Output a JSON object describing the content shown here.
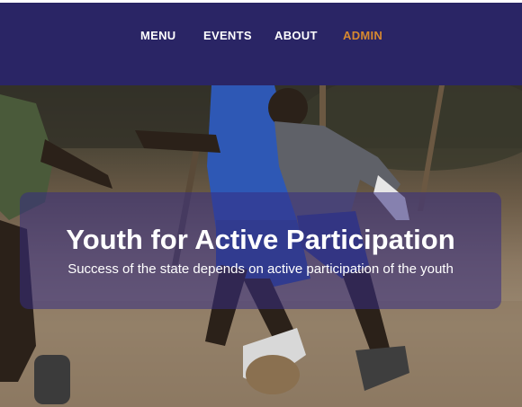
{
  "nav": {
    "items": [
      {
        "label": "MENU"
      },
      {
        "label": "EVENTS"
      },
      {
        "label": "ABOUT"
      },
      {
        "label": "ADMIN"
      }
    ],
    "active_item": "ADMIN",
    "background_color": "#2a2565",
    "active_color": "#d7892f"
  },
  "hero": {
    "title": "Youth for Active Participation",
    "subtitle": "Success of the state depends on active participation of the youth"
  }
}
